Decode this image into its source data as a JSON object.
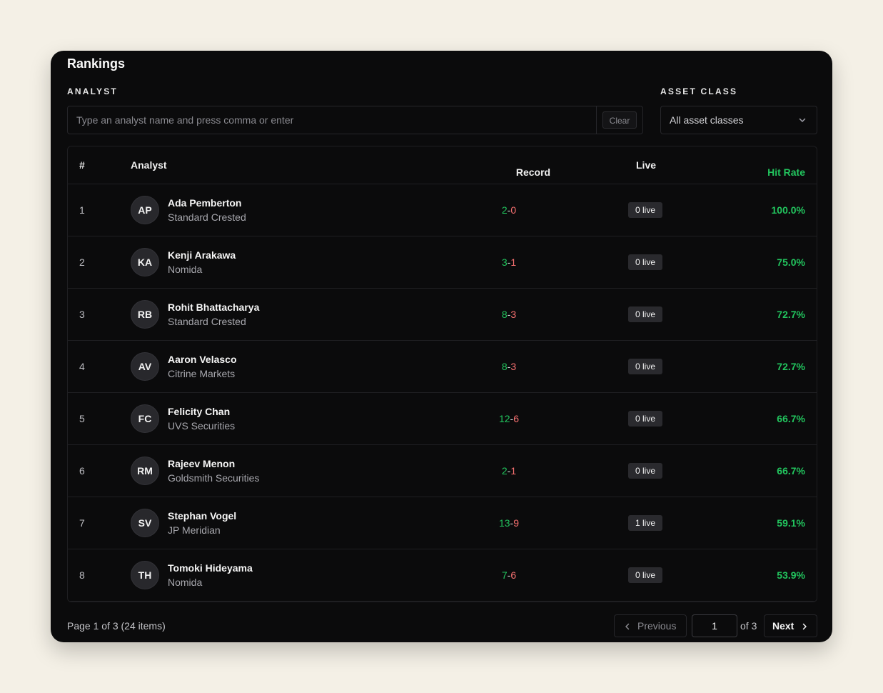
{
  "panel": {
    "title": "Rankings"
  },
  "filters": {
    "analyst_label": "ANALYST",
    "analyst_placeholder": "Type an analyst name and press comma or enter",
    "analyst_value": "",
    "clear_label": "Clear",
    "asset_label": "ASSET CLASS",
    "asset_selected": "All asset classes"
  },
  "table": {
    "columns": [
      "#",
      "Analyst",
      "Record",
      "Live",
      "Hit Rate"
    ],
    "rows": [
      {
        "rank": "1",
        "initials": "AP",
        "name": "Ada Pemberton",
        "firm": "Standard Crested",
        "wins": "2",
        "losses": "0",
        "live": "0 live",
        "hit_rate": "100.0%"
      },
      {
        "rank": "2",
        "initials": "KA",
        "name": "Kenji Arakawa",
        "firm": "Nomida",
        "wins": "3",
        "losses": "1",
        "live": "0 live",
        "hit_rate": "75.0%"
      },
      {
        "rank": "3",
        "initials": "RB",
        "name": "Rohit Bhattacharya",
        "firm": "Standard Crested",
        "wins": "8",
        "losses": "3",
        "live": "0 live",
        "hit_rate": "72.7%"
      },
      {
        "rank": "4",
        "initials": "AV",
        "name": "Aaron Velasco",
        "firm": "Citrine Markets",
        "wins": "8",
        "losses": "3",
        "live": "0 live",
        "hit_rate": "72.7%"
      },
      {
        "rank": "5",
        "initials": "FC",
        "name": "Felicity Chan",
        "firm": "UVS Securities",
        "wins": "12",
        "losses": "6",
        "live": "0 live",
        "hit_rate": "66.7%"
      },
      {
        "rank": "6",
        "initials": "RM",
        "name": "Rajeev Menon",
        "firm": "Goldsmith Securities",
        "wins": "2",
        "losses": "1",
        "live": "0 live",
        "hit_rate": "66.7%"
      },
      {
        "rank": "7",
        "initials": "SV",
        "name": "Stephan Vogel",
        "firm": "JP Meridian",
        "wins": "13",
        "losses": "9",
        "live": "1 live",
        "hit_rate": "59.1%"
      },
      {
        "rank": "8",
        "initials": "TH",
        "name": "Tomoki Hideyama",
        "firm": "Nomida",
        "wins": "7",
        "losses": "6",
        "live": "0 live",
        "hit_rate": "53.9%"
      }
    ]
  },
  "pagination": {
    "summary": "Page 1 of 3 (24 items)",
    "previous_label": "Previous",
    "page_value": "1",
    "of_label": "of 3",
    "next_label": "Next"
  },
  "colors": {
    "background": "#f4f0e6",
    "panel": "#0b0b0c",
    "win": "#22c55e",
    "loss": "#f87171",
    "hit_rate": "#22c55e"
  },
  "icons": {
    "select_chevron": "chevron-down-icon",
    "previous": "chevron-left-icon",
    "next": "chevron-right-icon"
  }
}
